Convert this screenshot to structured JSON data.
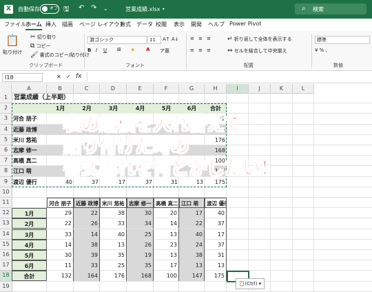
{
  "titlebar": {
    "app_icon": "X",
    "autosave_label": "自動保存",
    "toggle_state": "オフ",
    "filename": "営業成績.xlsx •",
    "search_placeholder": "検索",
    "icons": [
      "save-icon",
      "undo-icon",
      "redo-icon"
    ]
  },
  "tabs": [
    "ファイル",
    "ホーム",
    "挿入",
    "描画",
    "ページ レイアウト",
    "数式",
    "データ",
    "校閲",
    "表示",
    "開発",
    "ヘルプ",
    "Power Pivot"
  ],
  "active_tab": "ホーム",
  "ribbon": {
    "clipboard": {
      "paste": "貼り付け",
      "cut": "切り取り",
      "copy": "コピー",
      "format_painter": "書式のコピー/貼り付け",
      "label": "クリップボード"
    },
    "font": {
      "font_name": "游ゴシック",
      "font_size": "11",
      "label": "フォント"
    },
    "alignment": {
      "wrap": "折り返して全体を表示する",
      "merge": "セルを結合して中央揃え",
      "label": "配置"
    },
    "number": {
      "format": "標準",
      "label": "数値"
    }
  },
  "formula_bar": {
    "name_box": "I18",
    "fx": "fx"
  },
  "columns": [
    "A",
    "B",
    "C",
    "D",
    "E",
    "F",
    "G",
    "H",
    "I",
    "J",
    "K",
    "L"
  ],
  "rows": [
    "1",
    "2",
    "3",
    "4",
    "5",
    "6",
    "7",
    "8",
    "9",
    "10",
    "11",
    "12",
    "13",
    "14",
    "15",
    "16",
    "17",
    "18",
    "19"
  ],
  "sheet": {
    "title": "営業成績（上半期）",
    "table1": {
      "headers": [
        "1月",
        "2月",
        "3月",
        "4月",
        "5月",
        "6月",
        "合計"
      ],
      "names": [
        "河合 朋子",
        "近藤 政博",
        "米川 悠祐",
        "志摩 修一",
        "高橋 真二",
        "江口 萌",
        "渡辺 優行"
      ],
      "visible_values": [
        [
          "29",
          "",
          "",
          "",
          "",
          "",
          "132"
        ],
        [
          "22",
          "",
          "",
          "",
          "",
          "",
          "164"
        ],
        [
          "",
          "",
          "",
          "",
          "",
          "",
          "176"
        ],
        [
          "",
          "",
          "",
          "",
          "",
          "",
          "168"
        ],
        [
          "",
          "",
          "",
          "",
          "",
          "",
          "100"
        ],
        [
          "",
          "",
          "",
          "",
          "",
          "",
          "147"
        ],
        [
          "40",
          "37",
          "17",
          "37",
          "31",
          "13",
          "175"
        ]
      ]
    },
    "table2": {
      "headers": [
        "河合 朋子",
        "近藤 政博",
        "米川 悠祐",
        "志摩 修一",
        "高橋 真二",
        "江口 萌",
        "渡辺 優行"
      ],
      "row_labels": [
        "1月",
        "2月",
        "3月",
        "4月",
        "5月",
        "6月",
        "合計"
      ],
      "values": [
        [
          "29",
          "22",
          "38",
          "30",
          "20",
          "17",
          "40"
        ],
        [
          "22",
          "26",
          "33",
          "34",
          "14",
          "22",
          "37"
        ],
        [
          "33",
          "14",
          "40",
          "25",
          "13",
          "40",
          "17"
        ],
        [
          "14",
          "38",
          "13",
          "26",
          "23",
          "24",
          "37"
        ],
        [
          "30",
          "39",
          "35",
          "19",
          "13",
          "38",
          "31"
        ],
        [
          "11",
          "33",
          "25",
          "35",
          "17",
          "13",
          "13"
        ],
        [
          "132",
          "164",
          "176",
          "168",
          "100",
          "147",
          "175"
        ]
      ]
    }
  },
  "overlay_text": [
    "表の縦横を入れ替えて",
    "貼り付けた時の",
    "書式崩れを何とかしたい！"
  ],
  "paste_options": "(Ctrl) ▾",
  "colors": {
    "excel_green": "#1e7145",
    "header_fill": "#e2efda",
    "gray_fill": "#d9d9d9",
    "overlay_red": "#e02020"
  }
}
